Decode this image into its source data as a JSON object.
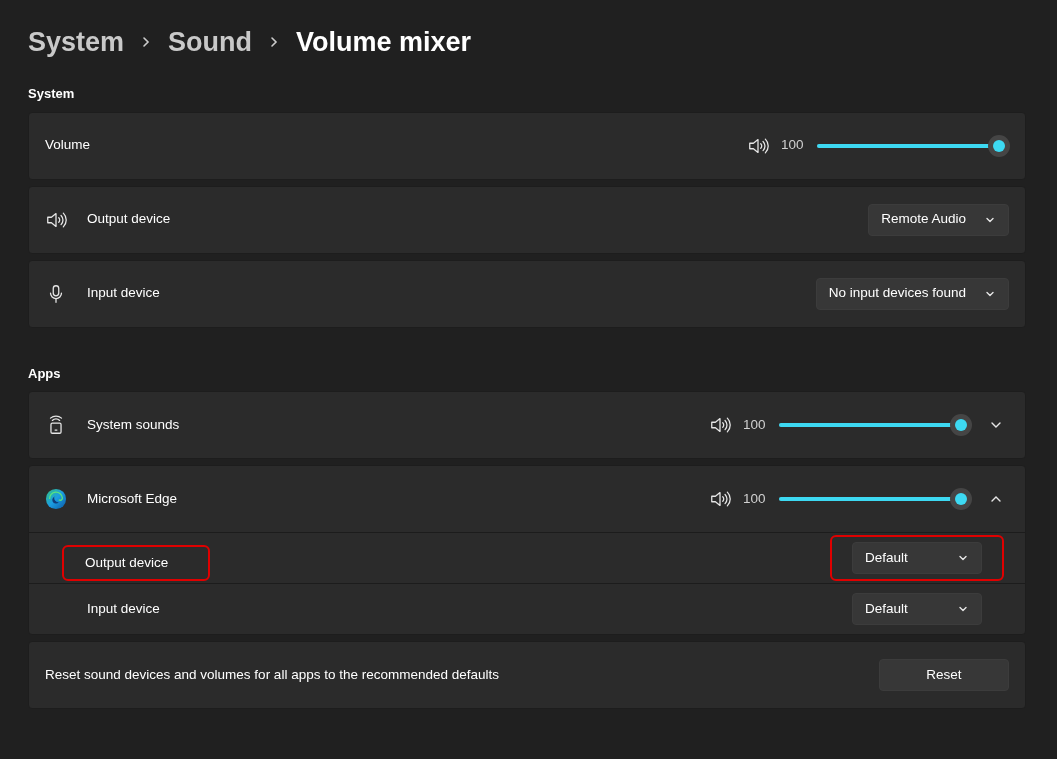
{
  "breadcrumb": [
    {
      "label": "System",
      "current": false
    },
    {
      "label": "Sound",
      "current": false
    },
    {
      "label": "Volume mixer",
      "current": true
    }
  ],
  "system": {
    "heading": "System",
    "volume": {
      "label": "Volume",
      "reading": "100",
      "level": 1
    },
    "devices": [
      {
        "kind": "output",
        "label": "Output device",
        "value": "Remote Audio"
      },
      {
        "kind": "input",
        "label": "Input device",
        "value": "No input devices found"
      }
    ]
  },
  "apps": {
    "heading": "Apps",
    "items": [
      {
        "kind": "system",
        "name": "System sounds",
        "reading": "100",
        "level": 1,
        "expanded": false
      },
      {
        "kind": "browser",
        "name": "Microsoft Edge",
        "reading": "100",
        "level": 1,
        "expanded": true,
        "settings": [
          {
            "label": "Output device",
            "value": "Default",
            "highlighted": true
          },
          {
            "label": "Input device",
            "value": "Default",
            "highlighted": false
          }
        ]
      }
    ]
  },
  "reset": {
    "text": "Reset sound devices and volumes for all apps to the recommended defaults",
    "button": "Reset"
  }
}
